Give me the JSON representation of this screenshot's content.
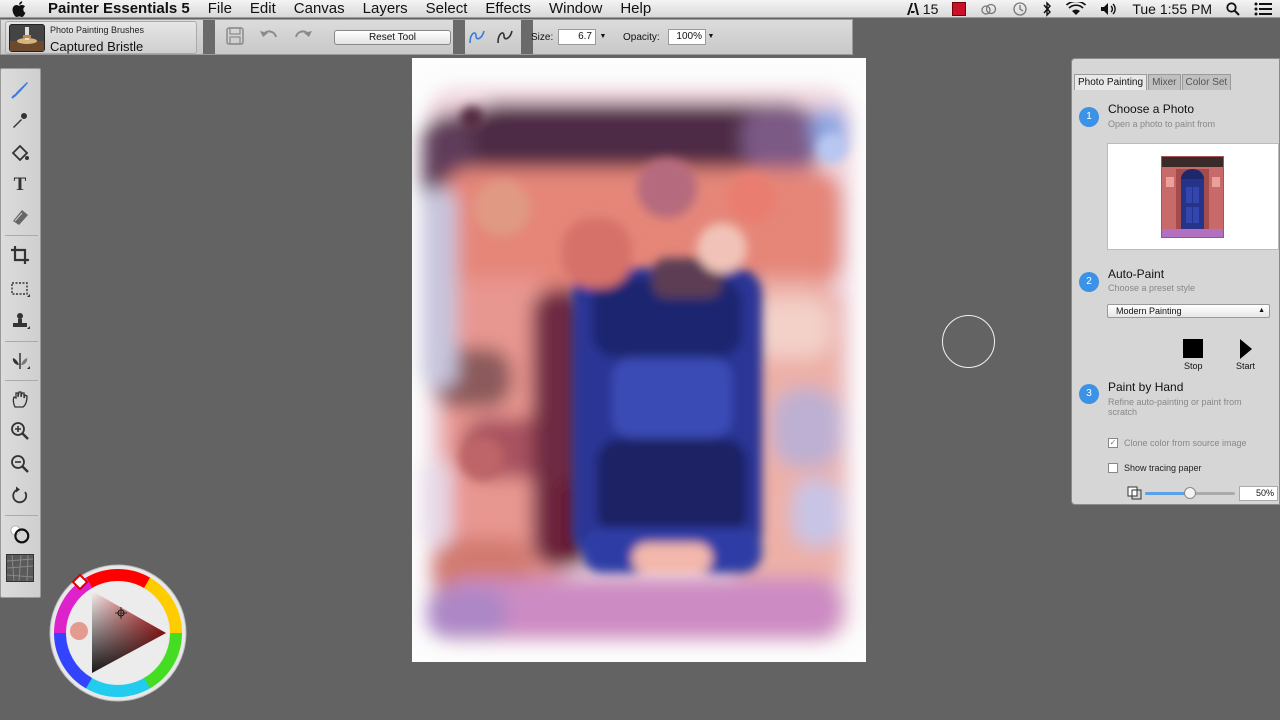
{
  "menubar": {
    "app_name": "Painter Essentials 5",
    "menus": [
      "File",
      "Edit",
      "Canvas",
      "Layers",
      "Select",
      "Effects",
      "Window",
      "Help"
    ],
    "status": {
      "adobe_count": "15",
      "clock": "Tue 1:55 PM"
    }
  },
  "propbar": {
    "brush_category": "Photo Painting Brushes",
    "brush_name": "Captured Bristle",
    "reset_label": "Reset Tool",
    "size_label": "Size:",
    "size_value": "6.7",
    "opacity_label": "Opacity:",
    "opacity_value": "100%"
  },
  "tools": [
    "brush-icon",
    "dropper-icon",
    "paint-bucket-icon",
    "text-icon",
    "eraser-icon",
    "crop-icon",
    "rect-select-icon",
    "clone-stamp-icon",
    "mirror-icon",
    "grabber-icon",
    "zoom-in-icon",
    "zoom-out-icon",
    "rotate-icon"
  ],
  "panel": {
    "tabs": [
      "Photo Painting",
      "Mixer",
      "Color Set"
    ],
    "step1": {
      "num": "1",
      "title": "Choose a Photo",
      "sub": "Open a photo to paint from"
    },
    "step2": {
      "num": "2",
      "title": "Auto-Paint",
      "sub": "Choose a preset style",
      "style_value": "Modern Painting",
      "stop_label": "Stop",
      "start_label": "Start"
    },
    "step3": {
      "num": "3",
      "title": "Paint by Hand",
      "sub": "Refine auto-painting or paint from scratch",
      "clone_label": "Clone color from source image",
      "tracing_label": "Show tracing paper",
      "tracing_opacity": "50%",
      "tracing_opacity_fraction": 0.5
    }
  },
  "colors": {
    "accent": "#3b92e6",
    "current_color": "#e59a8f"
  }
}
